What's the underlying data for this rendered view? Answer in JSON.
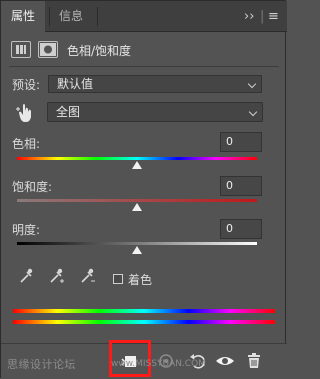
{
  "tabs": [
    {
      "label": "属性",
      "active": true
    },
    {
      "label": "信息",
      "active": false
    }
  ],
  "header": {
    "title": "色相/饱和度",
    "icons": [
      "adjustment-layer-icon",
      "mask-icon"
    ]
  },
  "preset": {
    "label": "预设:",
    "value": "默认值"
  },
  "channel": {
    "value": "全图",
    "icon": "hand-target-icon"
  },
  "sliders": [
    {
      "label": "色相:",
      "value": "0",
      "position": 0.5
    },
    {
      "label": "饱和度:",
      "value": "0",
      "position": 0.5
    },
    {
      "label": "明度:",
      "value": "0",
      "position": 0.5
    }
  ],
  "colorize": {
    "label": "着色",
    "checked": false
  },
  "eyedroppers": [
    "eyedropper-icon",
    "eyedropper-add-icon",
    "eyedropper-subtract-icon"
  ],
  "toolbar": {
    "buttons": [
      "clip-to-layer-icon",
      "view-previous-icon",
      "reset-icon",
      "visibility-icon",
      "delete-icon"
    ]
  },
  "watermark": {
    "text": "思缘设计论坛",
    "url_text": "www.MISSYUAN.COM"
  },
  "colors": {
    "panel_bg": "#535353",
    "tab_bg": "#3f3f3f",
    "highlight": "#ff1a1a"
  }
}
